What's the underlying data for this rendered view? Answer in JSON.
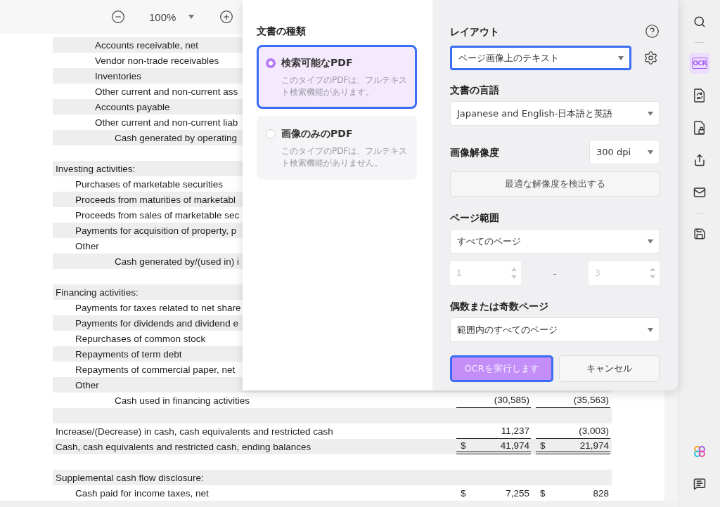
{
  "toolbar": {
    "zoom": "100%"
  },
  "statement": {
    "rows": [
      {
        "kind": "subitem",
        "label": "Accounts receivable, net"
      },
      {
        "kind": "subitem",
        "label": "Vendor non-trade receivables"
      },
      {
        "kind": "subitem",
        "label": "Inventories"
      },
      {
        "kind": "subitem",
        "label": "Other current and non-current ass"
      },
      {
        "kind": "subitem",
        "label": "Accounts payable"
      },
      {
        "kind": "subitem",
        "label": "Other current and non-current liab"
      },
      {
        "kind": "total",
        "label": "Cash generated by operating"
      },
      {
        "kind": "blank"
      },
      {
        "kind": "section",
        "label": "Investing activities:"
      },
      {
        "kind": "item",
        "label": "Purchases of marketable securities"
      },
      {
        "kind": "item",
        "label": "Proceeds from maturities of marketabl"
      },
      {
        "kind": "item",
        "label": "Proceeds from sales of marketable sec"
      },
      {
        "kind": "item",
        "label": "Payments for acquisition of property, p"
      },
      {
        "kind": "item",
        "label": "Other"
      },
      {
        "kind": "total",
        "label": "Cash generated by/(used in) i"
      },
      {
        "kind": "blank"
      },
      {
        "kind": "section",
        "label": "Financing activities:"
      },
      {
        "kind": "item",
        "label": "Payments for taxes related to net share"
      },
      {
        "kind": "item",
        "label": "Payments for dividends and dividend e"
      },
      {
        "kind": "item",
        "label": "Repurchases of common stock"
      },
      {
        "kind": "item",
        "label": "Repayments of term debt"
      },
      {
        "kind": "item",
        "label": "Repayments of commercial paper, net"
      },
      {
        "kind": "item",
        "label": "Other"
      },
      {
        "kind": "total",
        "label": "Cash used in financing activities",
        "underlined": true,
        "values": [
          {
            "amount": "(30,585)"
          },
          {
            "amount": "(35,563)"
          }
        ]
      },
      {
        "kind": "blank"
      },
      {
        "kind": "section",
        "label": "Increase/(Decrease) in cash, cash equivalents and restricted cash",
        "underlined": true,
        "values": [
          {
            "amount": "11,237"
          },
          {
            "amount": "(3,003)"
          }
        ]
      },
      {
        "kind": "section",
        "label": "Cash, cash equivalents and restricted cash, ending balances",
        "double_underlined": true,
        "values": [
          {
            "currency": "$",
            "amount": "41,974"
          },
          {
            "currency": "$",
            "amount": "21,974"
          }
        ]
      },
      {
        "kind": "blank"
      },
      {
        "kind": "section",
        "label": "Supplemental cash flow disclosure:"
      },
      {
        "kind": "item",
        "label": "Cash paid for income taxes, net",
        "values": [
          {
            "currency": "$",
            "amount": "7,255"
          },
          {
            "currency": "$",
            "amount": "828"
          }
        ]
      }
    ]
  },
  "ocr_dialog": {
    "document_type": {
      "title": "文書の種類",
      "options": [
        {
          "title": "検索可能なPDF",
          "description": "このタイプのPDFは、フルテキスト検索機能があります。",
          "selected": true
        },
        {
          "title": "画像のみのPDF",
          "description": "このタイプのPDFは、フルテキスト検索機能がありません。",
          "selected": false
        }
      ]
    },
    "layout": {
      "label": "レイアウト",
      "value": "ページ画像上のテキスト",
      "focused": true
    },
    "language": {
      "label": "文書の言語",
      "value": "Japanese and English-日本語と英語"
    },
    "resolution": {
      "label": "画像解像度",
      "value": "300 dpi",
      "detect_button": "最適な解像度を検出する"
    },
    "page_range": {
      "label": "ページ範囲",
      "value": "すべてのページ",
      "from": "1",
      "separator": "-",
      "to": "3",
      "disabled": true
    },
    "parity": {
      "label": "偶数または奇数ページ",
      "value": "範囲内のすべてのページ"
    },
    "buttons": [
      {
        "kind": "primary",
        "label": "OCRを実行します",
        "focused": true
      },
      {
        "kind": "secondary",
        "label": "キャンセル",
        "focused": false
      }
    ]
  },
  "sidebar": {
    "tools": [
      {
        "kind": "search",
        "selected": false
      },
      {
        "kind": "divider"
      },
      {
        "kind": "ocr",
        "label": "OCR",
        "selected": true
      },
      {
        "kind": "convert",
        "selected": false
      },
      {
        "kind": "protect",
        "selected": false
      },
      {
        "kind": "share",
        "selected": false
      },
      {
        "kind": "mail",
        "selected": false
      },
      {
        "kind": "divider"
      },
      {
        "kind": "save",
        "selected": false
      }
    ],
    "bottom_tools": [
      {
        "kind": "ai"
      },
      {
        "kind": "comment"
      }
    ]
  }
}
